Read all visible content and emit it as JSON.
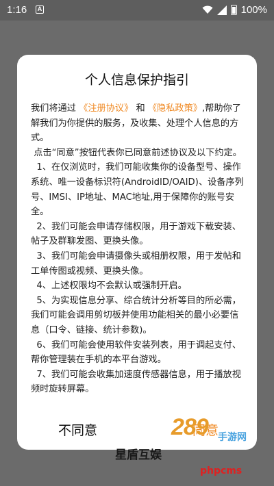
{
  "status_bar": {
    "time": "1:16",
    "notification_glyph": "A",
    "battery": "100%"
  },
  "dialog": {
    "title": "个人信息保护指引",
    "intro_prefix": "我们将通过",
    "link_terms": "《注册协议》",
    "and": "和",
    "link_privacy": "《隐私政策》",
    "intro_suffix": ",帮助你了解我们为你提供的服务，及收集、处理个人信息的方式。",
    "consent_note": "点击“同意”按钮代表你已同意前述协议及以下约定。",
    "items": [
      "1、在仅浏览时，我们可能收集你的设备型号、操作系统、唯一设备标识符(AndroidID/OAID)、设备序列号、IMSI、IP地址、MAC地址,用于保障你的账号安全。",
      "2、我们可能会申请存储权限，用于游戏下载安装、帖子及群聊发图、更换头像。",
      "3、我们可能会申请摄像头或相册权限，用于发帖和工单传图或视频、更换头像。",
      "4、上述权限均不会默认或强制开启。",
      "5、为实现信息分享、综合统计分析等目的所必需，我们可能会调用剪切板并使用功能相关的最小必要信息（口令、链接、统计参数)。",
      "6、我们可能会使用软件安装列表，用于调起支付、帮你管理装在手机的本平台游戏。",
      "7、我们可能会收集加速度传感器信息，用于播放视频时旋转屏幕。"
    ],
    "disagree_label": "不同意",
    "agree_label": "同意"
  },
  "footer": {
    "app_name_partial": "星盾互娱"
  },
  "watermarks": {
    "site_logo": "289",
    "site_sub": "手游网",
    "site_tag": "phpcms"
  },
  "colors": {
    "accent": "#f08a24",
    "overlay": "#6b6b6b"
  }
}
